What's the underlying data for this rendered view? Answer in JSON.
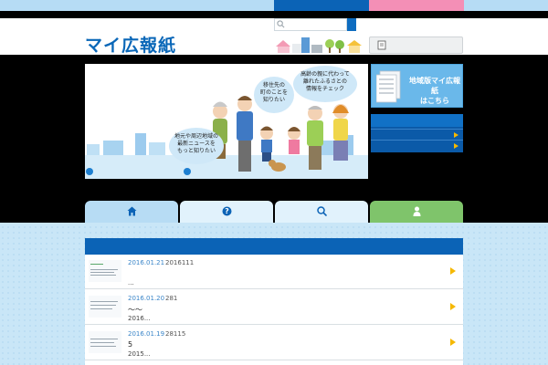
{
  "header": {
    "logo_text": "マイ広報紙",
    "search_icon": "search-icon",
    "login_icon": "document-icon"
  },
  "hero": {
    "bubble_left": [
      "地元や周辺地域の",
      "最新ニュースを",
      "もっと知りたい"
    ],
    "bubble_mid": [
      "移住先の",
      "町のことを",
      "知りたい"
    ],
    "bubble_right": [
      "高齢の親に代わって",
      "離れたふるさとの",
      "情報をチェック"
    ]
  },
  "side_banner": {
    "line1": "地域版マイ広報紙",
    "line2": "はこちら"
  },
  "tabs": [
    {
      "icon": "home-icon",
      "color": "#b7dcf4"
    },
    {
      "icon": "help-icon",
      "color": "#e1f2fc"
    },
    {
      "icon": "search-icon",
      "color": "#e1f2fc"
    },
    {
      "icon": "user-icon",
      "color": "#7fc46b"
    }
  ],
  "news": [
    {
      "date": "2016.01.21",
      "number": "2016111",
      "title": "",
      "sub": "..."
    },
    {
      "date": "2016.01.20",
      "number": "281",
      "title": "～～",
      "sub": "2016..."
    },
    {
      "date": "2016.01.19",
      "number": "28115",
      "title": "5",
      "sub": "2015..."
    }
  ],
  "colors": {
    "brand_blue": "#0b63b6",
    "accent_pink": "#f48fb6",
    "arrow_yellow": "#f5b800"
  }
}
